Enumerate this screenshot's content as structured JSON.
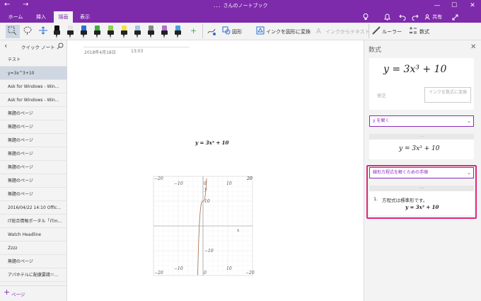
{
  "window": {
    "title": "さんのノートブック",
    "title_prefix": "．．．",
    "back": "←",
    "forward": "→",
    "minimize": "—",
    "maximize": "☐",
    "close": "✕"
  },
  "ribbon": {
    "tabs": [
      {
        "label": "ホーム"
      },
      {
        "label": "挿入"
      },
      {
        "label": "描画"
      },
      {
        "label": "表示"
      }
    ],
    "active_tab": "描画",
    "share_label": "共有",
    "right_icons": [
      "lightbulb-icon",
      "bell-icon",
      "undo-icon",
      "redo-icon",
      "share-icon",
      "expand-icon"
    ]
  },
  "toolbar": {
    "pens": [
      {
        "color": "#111111"
      },
      {
        "color": "#e3e3e3"
      },
      {
        "color": "#2a6fd6"
      },
      {
        "color": "#3cb043"
      },
      {
        "color": "#8fd14f"
      },
      {
        "color": "#f5e14a"
      },
      {
        "color": "#9fc5e8"
      },
      {
        "color": "#888888"
      },
      {
        "color": "#b06fd0"
      },
      {
        "color": "#4aa3df"
      }
    ],
    "add_pen": "+",
    "shapes_label": "図形",
    "ink_to_shape_label": "インクを図形に変換",
    "ink_to_text_label": "インクからテキスト",
    "ruler_label": "ルーラー",
    "math_label": "数式"
  },
  "sidebar": {
    "title": "クイック ノート",
    "back": "‹",
    "pages": [
      {
        "label": "テスト"
      },
      {
        "label": "y=3x^3+10"
      },
      {
        "label": "Ask for Windows - Win..."
      },
      {
        "label": "Ask for Windows - Win..."
      },
      {
        "label": "無題のページ"
      },
      {
        "label": "無題のページ"
      },
      {
        "label": "無題のページ"
      },
      {
        "label": "無題のページ"
      },
      {
        "label": "無題のページ"
      },
      {
        "label": "無題のページ"
      },
      {
        "label": "無題のページ"
      },
      {
        "label": "2016/04/22 14:10 Offic..."
      },
      {
        "label": "IT総合情報ポータル「ITm..."
      },
      {
        "label": "Watch Headline"
      },
      {
        "label": "Zzzz"
      },
      {
        "label": "無題のページ"
      },
      {
        "label": "アパホテルに配慮要請＝..."
      }
    ],
    "selected_index": 1,
    "add_page_label": "ページ"
  },
  "note": {
    "date": "2018年4月18日",
    "time": "13:03",
    "equation": "y = 3x³ + 10",
    "graph": {
      "x_ticks": [
        "−10",
        "0",
        "10",
        "20",
        "−20"
      ],
      "y_ticks": [
        "20",
        "10",
        "−10",
        "−20"
      ],
      "x_axis_label": "x",
      "y_axis_label": "y",
      "top_labels": {
        "left": "−20",
        "mid1": "−10",
        "zero": "0",
        "right1": "10",
        "right": "20"
      },
      "bottom_labels": {
        "left": "−20",
        "mid1": "−10",
        "zero": "0",
        "right1": "10",
        "right": "20"
      }
    }
  },
  "math_panel": {
    "title": "数式",
    "close": "✕",
    "equation": "y = 3x³ + 10",
    "fix_label": "修正",
    "ink_to_math_label": "インクを数式に変換",
    "solve_dropdown": "y を解く",
    "solved_equation": "y = 3x³ + 10",
    "steps_dropdown": "線形方程式を解くための手順",
    "step_number": "1.",
    "step_text": "方程式は標準形です。",
    "step_equation": "y = 3x³ + 10",
    "separator": "....",
    "highlight_color": "#e0287a"
  }
}
